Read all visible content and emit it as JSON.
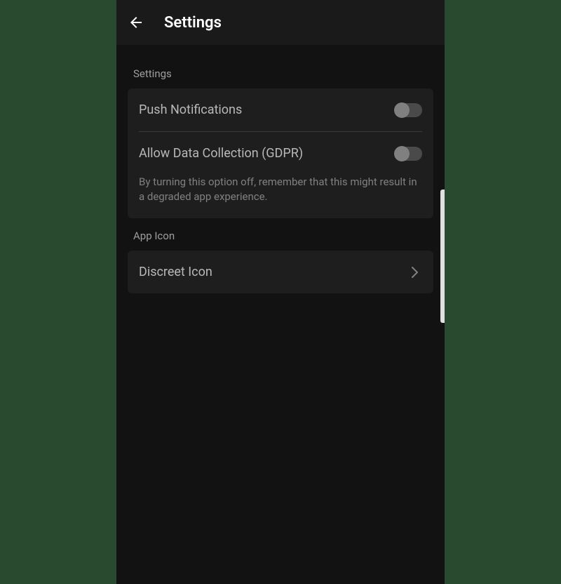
{
  "header": {
    "title": "Settings"
  },
  "sections": {
    "settings": {
      "label": "Settings",
      "pushNotifications": {
        "label": "Push Notifications",
        "enabled": false
      },
      "dataCollection": {
        "label": "Allow Data Collection (GDPR)",
        "enabled": false,
        "description": "By turning this option off, remember that this might result in a degraded app experience."
      }
    },
    "appIcon": {
      "label": "App Icon",
      "discreetIcon": {
        "label": "Discreet Icon"
      }
    }
  }
}
